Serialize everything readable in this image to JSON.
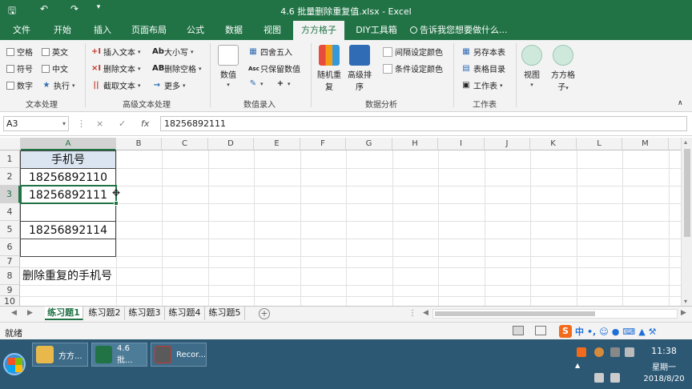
{
  "window": {
    "title": "4.6 批量删除重复值.xlsx - Excel"
  },
  "quick_access": {
    "save": "save-icon",
    "undo": "undo-icon",
    "redo": "redo-icon",
    "customize": "dropdown-icon"
  },
  "tabs": [
    {
      "label": "文件"
    },
    {
      "label": "开始"
    },
    {
      "label": "插入"
    },
    {
      "label": "页面布局"
    },
    {
      "label": "公式"
    },
    {
      "label": "数据"
    },
    {
      "label": "视图"
    },
    {
      "label": "方方格子",
      "active": true
    },
    {
      "label": "DIY工具箱"
    }
  ],
  "tell_me": "告诉我您想要做什么...",
  "ribbon": {
    "text_processing": {
      "items": [
        "空格",
        "英文",
        "符号",
        "中文",
        "数字",
        "执行"
      ],
      "label": "文本处理"
    },
    "advanced_text": {
      "items": [
        "插入文本",
        "大小写",
        "删除文本",
        "删除空格",
        "截取文本",
        "更多"
      ],
      "label": "高级文本处理"
    },
    "numeric_input": {
      "value_btn": "数值",
      "round": "四舍五入",
      "keep_values": "只保留数值",
      "label": "数值录入"
    },
    "data_analysis": {
      "random_repeat": "随机重复",
      "advanced_sort": "高级排序",
      "interval_color": "间隔设定颜色",
      "cond_color": "条件设定颜色",
      "label": "数据分析"
    },
    "worksheet": {
      "save_as": "另存本表",
      "table_dir": "表格目录",
      "sheet": "工作表",
      "label": "工作表"
    },
    "view": "视图",
    "fangfang": "方方格子"
  },
  "formula_bar": {
    "name_box": "A3",
    "value": "18256892111"
  },
  "columns": [
    "A",
    "B",
    "C",
    "D",
    "E",
    "F",
    "G",
    "H",
    "I",
    "J",
    "K",
    "L",
    "M"
  ],
  "rows": [
    "1",
    "2",
    "3",
    "4",
    "5",
    "6",
    "7",
    "8",
    "9",
    "10"
  ],
  "cells": {
    "A1": "手机号",
    "A2": "18256892110",
    "A3": "18256892111",
    "A4": "",
    "A5": "18256892114",
    "A6": "",
    "A8": "删除重复的手机号"
  },
  "sheets": [
    {
      "label": "练习题1",
      "active": true
    },
    {
      "label": "练习题2"
    },
    {
      "label": "练习题3"
    },
    {
      "label": "练习题4"
    },
    {
      "label": "练习题5"
    }
  ],
  "status": {
    "ready": "就绪",
    "ime_lang": "中"
  },
  "taskbar": {
    "items": [
      {
        "label": "方方...",
        "icon": "folder-icon"
      },
      {
        "label": "4.6 批...",
        "icon": "excel-icon"
      },
      {
        "label": "Recor...",
        "icon": "recorder-icon"
      }
    ],
    "time": "11:38",
    "weekday": "星期一",
    "date": "2018/8/20"
  },
  "colors": {
    "excel_green": "#217346",
    "taskbar": "#2c5874"
  }
}
